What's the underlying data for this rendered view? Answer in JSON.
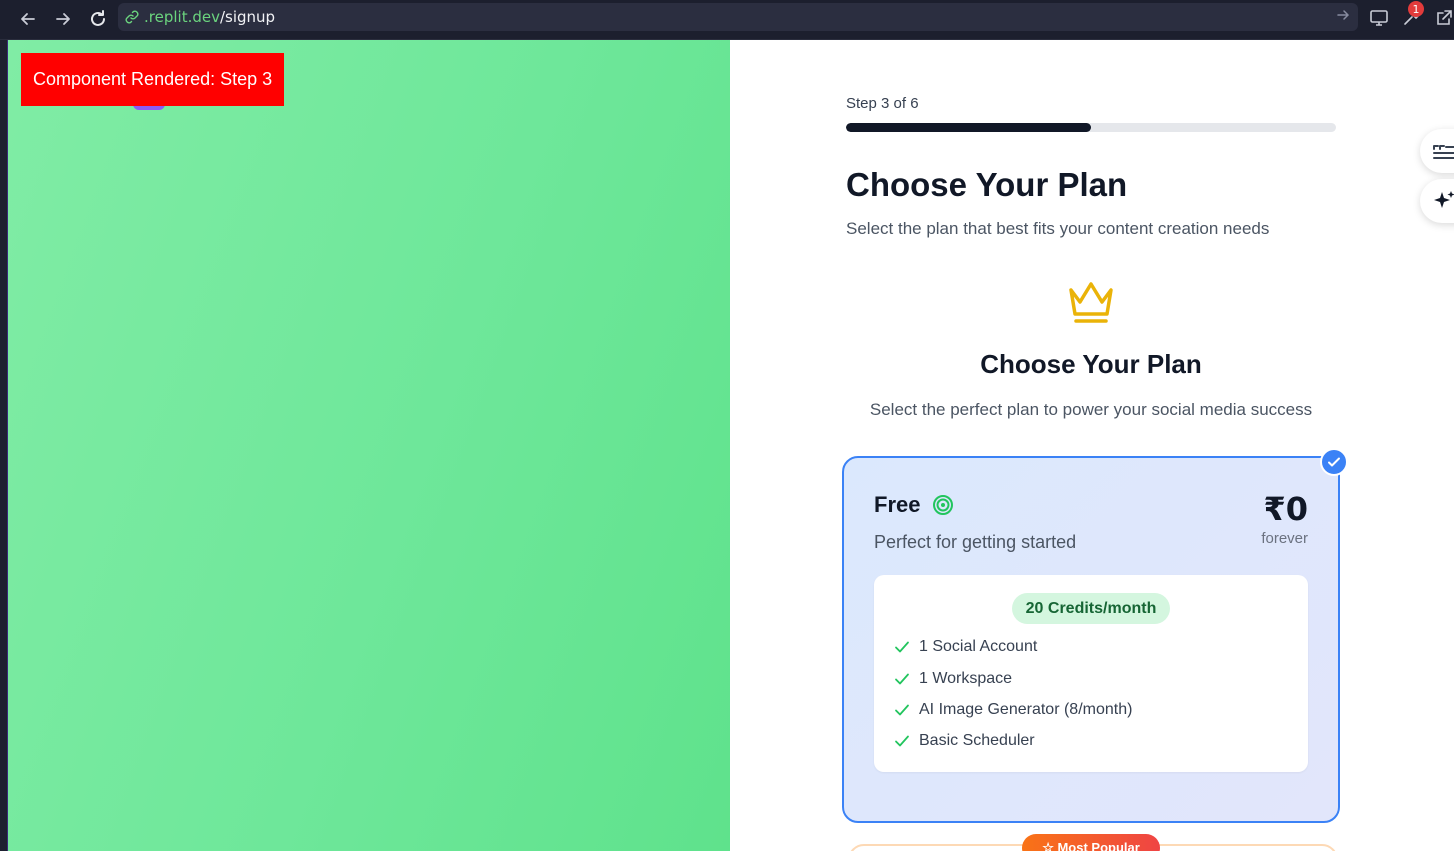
{
  "browser": {
    "url_domain": ".replit.dev",
    "url_path": "/signup",
    "notification_count": "1"
  },
  "debug": {
    "label": "Component Rendered: Step 3"
  },
  "signup": {
    "step_label": "Step 3 of 6",
    "progress": 0.5,
    "title": "Choose Your Plan",
    "subtitle": "Select the plan that best fits your content creation needs",
    "section_title": "Choose Your Plan",
    "section_subtitle": "Select the perfect plan to power your social media success"
  },
  "plans": [
    {
      "name": "Free",
      "description": "Perfect for getting started",
      "price": "₹0",
      "period": "forever",
      "credits": "20 Credits/month",
      "selected": true,
      "features": [
        "1 Social Account",
        "1 Workspace",
        "AI Image Generator (8/month)",
        "Basic Scheduler"
      ]
    },
    {
      "badge": "☆ Most Popular"
    }
  ],
  "colors": {
    "accent": "#3b82f6",
    "crown": "#eab308",
    "check": "#22c55e",
    "left_panel": "#6ee79a",
    "debug_bg": "#ff0000"
  },
  "icons": {
    "back": "arrow-left-icon",
    "forward": "arrow-right-icon",
    "reload": "reload-icon",
    "link": "link-icon",
    "crown": "crown-icon",
    "target": "target-icon",
    "check": "check-icon"
  }
}
